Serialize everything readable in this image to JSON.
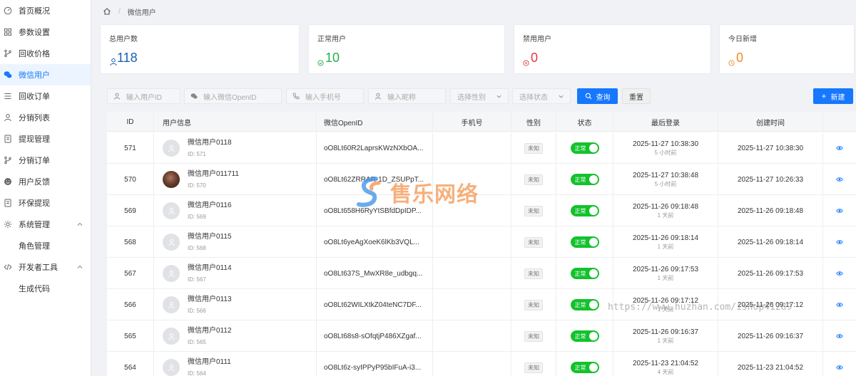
{
  "sidebar": {
    "items": [
      {
        "label": "首页概况",
        "icon": "dashboard-icon",
        "active": false
      },
      {
        "label": "参数设置",
        "icon": "grid-icon",
        "active": false
      },
      {
        "label": "回收价格",
        "icon": "branch-icon",
        "active": false
      },
      {
        "label": "微信用户",
        "icon": "wechat-icon",
        "active": true
      },
      {
        "label": "回收订单",
        "icon": "list-icon",
        "active": false
      },
      {
        "label": "分销列表",
        "icon": "user-icon",
        "active": false
      },
      {
        "label": "提现管理",
        "icon": "document-icon",
        "active": false
      },
      {
        "label": "分销订单",
        "icon": "branch-icon",
        "active": false
      },
      {
        "label": "用户反馈",
        "icon": "smile-icon",
        "active": false
      },
      {
        "label": "环保提现",
        "icon": "document-icon",
        "active": false
      },
      {
        "label": "系统管理",
        "icon": "gear-icon",
        "active": false,
        "expandable": true
      },
      {
        "label": "角色管理",
        "icon": "",
        "active": false,
        "sub": true
      },
      {
        "label": "开发者工具",
        "icon": "code-icon",
        "active": false,
        "expandable": true
      },
      {
        "label": "生成代码",
        "icon": "",
        "active": false,
        "sub": true
      }
    ]
  },
  "breadcrumb": {
    "current": "微信用户"
  },
  "stats": [
    {
      "label": "总用户数",
      "value": "118",
      "color": "#1a5fb4",
      "icon": "user-icon"
    },
    {
      "label": "正常用户",
      "value": "10",
      "color": "#22b14c",
      "icon": "check-circle-icon"
    },
    {
      "label": "禁用用户",
      "value": "0",
      "color": "#e5383b",
      "icon": "ban-icon"
    },
    {
      "label": "今日新增",
      "value": "0",
      "color": "#f08a24",
      "icon": "clock-icon"
    }
  ],
  "filters": {
    "user_id_placeholder": "输入用户ID",
    "openid_placeholder": "输入微信OpenID",
    "phone_placeholder": "输入手机号",
    "nickname_placeholder": "输入昵称",
    "gender_placeholder": "选择性别",
    "status_placeholder": "选择状态",
    "search_label": "查询",
    "reset_label": "重置",
    "add_label": "新建"
  },
  "table": {
    "columns": [
      "ID",
      "用户信息",
      "微信OpenID",
      "手机号",
      "性别",
      "状态",
      "最后登录",
      "创建时间"
    ],
    "rows": [
      {
        "id": "571",
        "name": "微信用户0118",
        "uid": "ID: 571",
        "openid": "oO8Lt60R2LaprsKWzNXbOA...",
        "phone": "",
        "gender": "未知",
        "status": "正常",
        "last_login": "2025-11-27 10:38:30",
        "last_login_rel": "5 小时前",
        "created": "2025-11-27 10:38:30",
        "photo": false
      },
      {
        "id": "570",
        "name": "微信用户011711",
        "uid": "ID: 570",
        "openid": "oO8Lt62ZRRAR-1D_ZSUPpT...",
        "phone": "",
        "gender": "未知",
        "status": "正常",
        "last_login": "2025-11-27 10:38:48",
        "last_login_rel": "5 小时前",
        "created": "2025-11-27 10:26:33",
        "photo": true
      },
      {
        "id": "569",
        "name": "微信用户0116",
        "uid": "ID: 569",
        "openid": "oO8Lt658H6RyYtSBfdDpIDP...",
        "phone": "",
        "gender": "未知",
        "status": "正常",
        "last_login": "2025-11-26 09:18:48",
        "last_login_rel": "1 天前",
        "created": "2025-11-26 09:18:48",
        "photo": false
      },
      {
        "id": "568",
        "name": "微信用户0115",
        "uid": "ID: 568",
        "openid": "oO8Lt6yeAgXoeK6lKb3VQL...",
        "phone": "",
        "gender": "未知",
        "status": "正常",
        "last_login": "2025-11-26 09:18:14",
        "last_login_rel": "1 天前",
        "created": "2025-11-26 09:18:14",
        "photo": false
      },
      {
        "id": "567",
        "name": "微信用户0114",
        "uid": "ID: 567",
        "openid": "oO8Lt637S_MwXR8e_udbgq...",
        "phone": "",
        "gender": "未知",
        "status": "正常",
        "last_login": "2025-11-26 09:17:53",
        "last_login_rel": "1 天前",
        "created": "2025-11-26 09:17:53",
        "photo": false
      },
      {
        "id": "566",
        "name": "微信用户0113",
        "uid": "ID: 566",
        "openid": "oO8Lt62WILXtkZ04teNC7DF...",
        "phone": "",
        "gender": "未知",
        "status": "正常",
        "last_login": "2025-11-26 09:17:12",
        "last_login_rel": "1 天前",
        "created": "2025-11-26 09:17:12",
        "photo": false
      },
      {
        "id": "565",
        "name": "微信用户0112",
        "uid": "ID: 565",
        "openid": "oO8Lt68s8-sOfqtjP486XZgaf...",
        "phone": "",
        "gender": "未知",
        "status": "正常",
        "last_login": "2025-11-26 09:16:37",
        "last_login_rel": "1 天前",
        "created": "2025-11-26 09:16:37",
        "photo": false
      },
      {
        "id": "564",
        "name": "微信用户0111",
        "uid": "ID: 564",
        "openid": "oO8Lt6z-syIPPyP95bIFuA-i3...",
        "phone": "",
        "gender": "未知",
        "status": "正常",
        "last_login": "2025-11-23 21:04:52",
        "last_login_rel": "4 天前",
        "created": "2025-11-23 21:04:52",
        "photo": false
      }
    ]
  },
  "watermark": {
    "logo_text": "售乐网络",
    "url_text": "https://www.huzhan.com/ishop41289"
  }
}
